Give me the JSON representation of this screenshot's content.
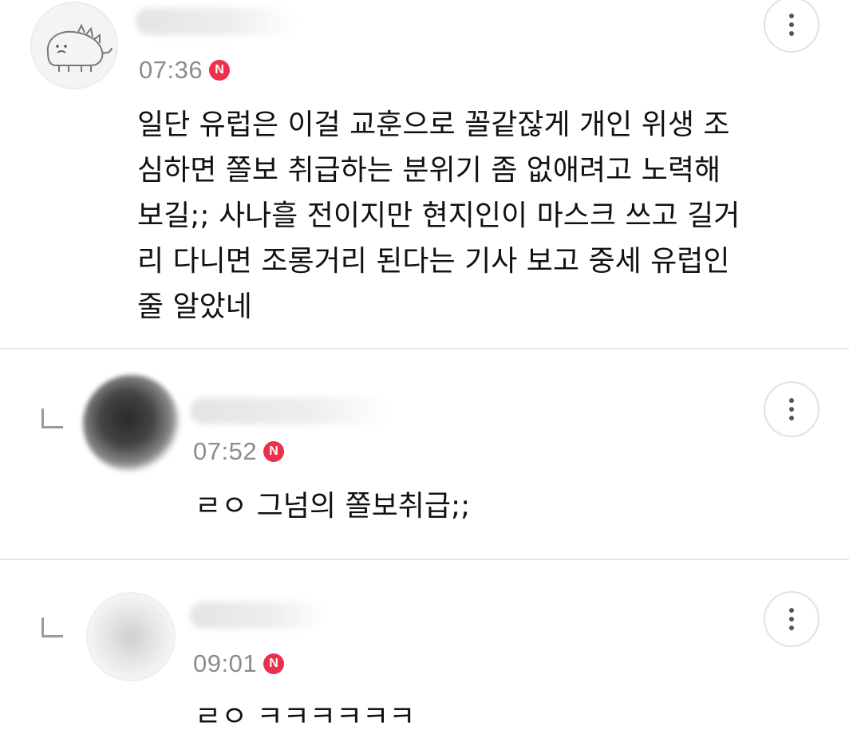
{
  "comments": [
    {
      "time": "07:36",
      "badge": "N",
      "text": "일단 유럽은 이걸 교훈으로 꼴같잖게 개인 위생 조\n심하면 쫄보 취급하는 분위기 좀 없애려고 노력해\n보길;; 사나흘 전이지만 현지인이 마스크 쓰고 길거\n리 다니면 조롱거리 된다는 기사 보고 중세 유럽인\n줄 알았네",
      "avatar_icon": "dinosaur-avatar-icon"
    },
    {
      "time": "07:52",
      "badge": "N",
      "text": "ㄹㅇ 그넘의 쫄보취급;;"
    },
    {
      "time": "09:01",
      "badge": "N",
      "text": "ㄹㅇ ㅋㅋㅋㅋㅋㅋ"
    }
  ],
  "colors": {
    "badge": "#ec2f4b",
    "time": "#8c8c8c",
    "divider": "#e6e6e6"
  }
}
